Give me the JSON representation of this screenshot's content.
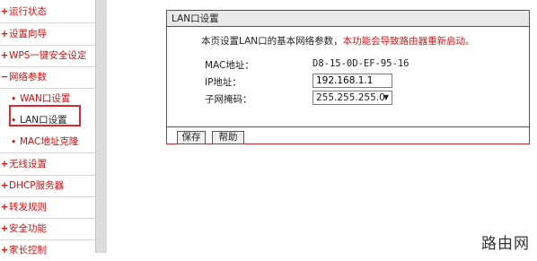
{
  "sidebar": {
    "items": [
      {
        "label": "运行状态"
      },
      {
        "label": "设置向导"
      },
      {
        "label": "WPS一键安全设定"
      },
      {
        "label": "网络参数"
      },
      {
        "label": "WAN口设置"
      },
      {
        "label": "LAN口设置"
      },
      {
        "label": "MAC地址克隆"
      },
      {
        "label": "无线设置"
      },
      {
        "label": "DHCP服务器"
      },
      {
        "label": "转发规则"
      },
      {
        "label": "安全功能"
      },
      {
        "label": "家长控制"
      }
    ]
  },
  "panel": {
    "title": "LAN口设置",
    "intro_text": "本页设置LAN口的基本网络参数，",
    "intro_warning": "本功能会导致路由器重新启动。",
    "mac_label": "MAC地址：",
    "mac_value": "D8-15-0D-EF-95-16",
    "ip_label": "IP地址：",
    "ip_value": "192.168.1.1",
    "mask_label": "子网掩码：",
    "mask_value": "255.255.255.0",
    "save_label": "保存",
    "help_label": "帮助"
  },
  "watermark": "路由网",
  "colors": {
    "accent": "#cc1111",
    "border": "#c0272d",
    "highlight": "#e0262a"
  }
}
